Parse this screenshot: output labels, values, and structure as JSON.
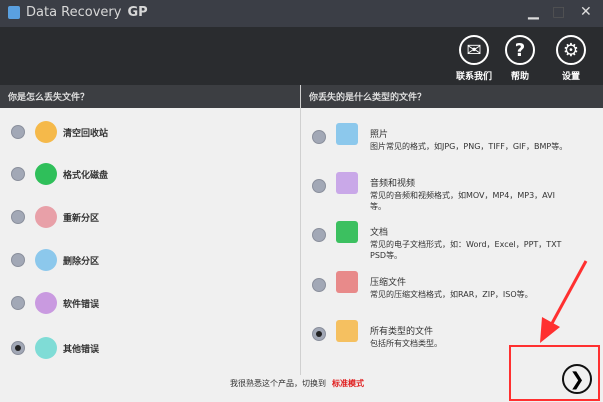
{
  "window": {
    "title": "Data Recovery",
    "title_suffix": "GP",
    "min": "▁",
    "max": "□",
    "close": "✕"
  },
  "header": {
    "buttons": [
      {
        "label": "联系我们",
        "glyph": "✉"
      },
      {
        "label": "帮助",
        "glyph": "?"
      },
      {
        "label": "设置",
        "glyph": "⚙"
      }
    ]
  },
  "left": {
    "heading": "你是怎么丢失文件？",
    "items": [
      {
        "label": "清空回收站",
        "color": "#f5b94a",
        "selected": false
      },
      {
        "label": "格式化磁盘",
        "color": "#2fbf5a",
        "selected": false
      },
      {
        "label": "重新分区",
        "color": "#e8a0a8",
        "selected": false
      },
      {
        "label": "删除分区",
        "color": "#8cc8ec",
        "selected": false
      },
      {
        "label": "软件错误",
        "color": "#c99ae0",
        "selected": false
      },
      {
        "label": "其他错误",
        "color": "#7fdcd6",
        "selected": true
      }
    ]
  },
  "right": {
    "heading": "你丢失的是什么类型的文件？",
    "items": [
      {
        "title": "照片",
        "desc": "图片常见的格式，如JPG，PNG，TIFF，GIF，BMP等。",
        "color": "#8cc8ec",
        "selected": false
      },
      {
        "title": "音频和视频",
        "desc": "常见的音频和视频格式，如MOV，MP4，MP3，AVI等。",
        "color": "#c9a8e8",
        "selected": false
      },
      {
        "title": "文档",
        "desc": "常见的电子文档形式，如：Word，Excel，PPT，TXT PSD等。",
        "color": "#3cc060",
        "selected": false
      },
      {
        "title": "压缩文件",
        "desc": "常见的压缩文档格式，如RAR，ZIP，ISO等。",
        "color": "#e88a8a",
        "selected": false
      },
      {
        "title": "所有类型的文件",
        "desc": "包括所有文档类型。",
        "color": "#f5c060",
        "selected": true
      }
    ]
  },
  "footer": {
    "text": "我很熟悉这个产品，切换到",
    "link": "标准模式",
    "next": "❯"
  }
}
